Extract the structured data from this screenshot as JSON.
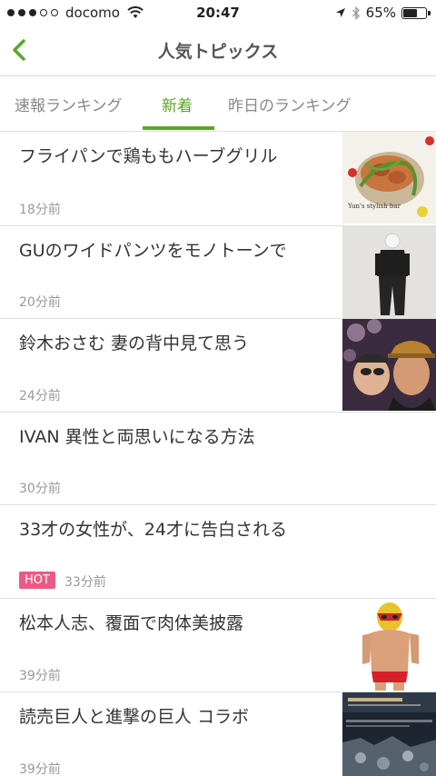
{
  "status": {
    "carrier": "docomo",
    "time": "20:47",
    "battery": "65%",
    "battery_level": 0.65,
    "signal_bars": 3,
    "signal_total": 5
  },
  "nav": {
    "title": "人気トピックス",
    "back_icon": "chevron-left-icon"
  },
  "tabs": [
    {
      "label": "速報ランキング"
    },
    {
      "label": "新着",
      "active": true
    },
    {
      "label": "昨日のランキング"
    }
  ],
  "colors": {
    "accent": "#57a826",
    "hot_badge": "#ea5a84"
  },
  "articles": [
    {
      "title": "フライパンで鶏ももハーブグリル",
      "time": "18分前",
      "has_image": true,
      "image": "herb-grilled-chicken-photo",
      "image_caption": "Yun's stylish bar"
    },
    {
      "title": "GUのワイドパンツをモノトーンで",
      "time": "20分前",
      "has_image": true,
      "image": "monotone-outfit-photo"
    },
    {
      "title": "鈴木おさむ 妻の背中見て思う",
      "time": "24分前",
      "has_image": true,
      "image": "couple-selfie-photo"
    },
    {
      "title": "IVAN 異性と両思いになる方法",
      "time": "30分前",
      "has_image": false
    },
    {
      "title": "33才の女性が、24才に告白される",
      "time": "33分前",
      "hot": "HOT",
      "has_image": false
    },
    {
      "title": "松本人志、覆面で肉体美披露",
      "time": "39分前",
      "has_image": true,
      "image": "masked-wrestler-photo"
    },
    {
      "title": "読売巨人と進撃の巨人 コラボ",
      "time": "39分前",
      "has_image": true,
      "image": "attack-on-titan-collab-poster"
    }
  ]
}
